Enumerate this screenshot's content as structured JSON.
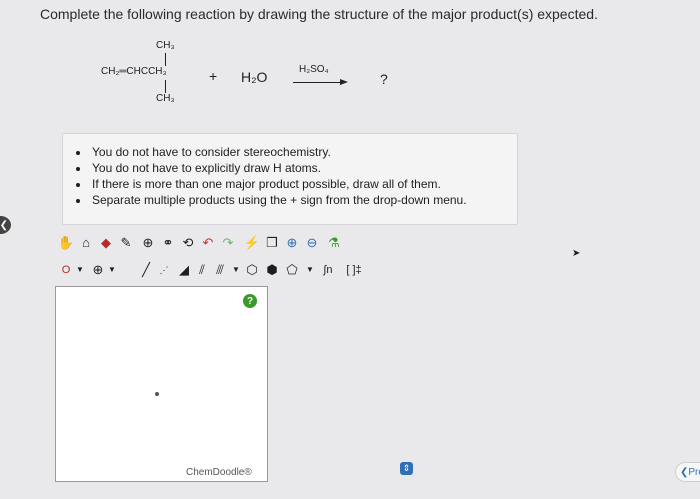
{
  "question": "Complete the following reaction by drawing the structure of the major product(s) expected.",
  "reaction": {
    "top_methyl": "CH₃",
    "main_chain": "CH₂═CHCCH₃",
    "bottom_methyl": "CH₃",
    "plus": "+",
    "water": "H₂O",
    "catalyst": "H₂SO₄",
    "product": "?"
  },
  "instructions": [
    "You do not have to consider stereochemistry.",
    "You do not have to explicitly draw H atoms.",
    "If there is more than one major product possible, draw all of them.",
    "Separate multiple products using the + sign from the drop-down menu."
  ],
  "toolbar": {
    "atom_label": "O",
    "charge_label": "⊕",
    "template_label": "∫n",
    "bracket_label": "[ ]‡"
  },
  "canvas": {
    "help_label": "?",
    "brand": "ChemDoodle®"
  },
  "nav": {
    "prev_label": "❮Pre",
    "spinner_label": "⇕",
    "left_tab_label": "❮"
  }
}
